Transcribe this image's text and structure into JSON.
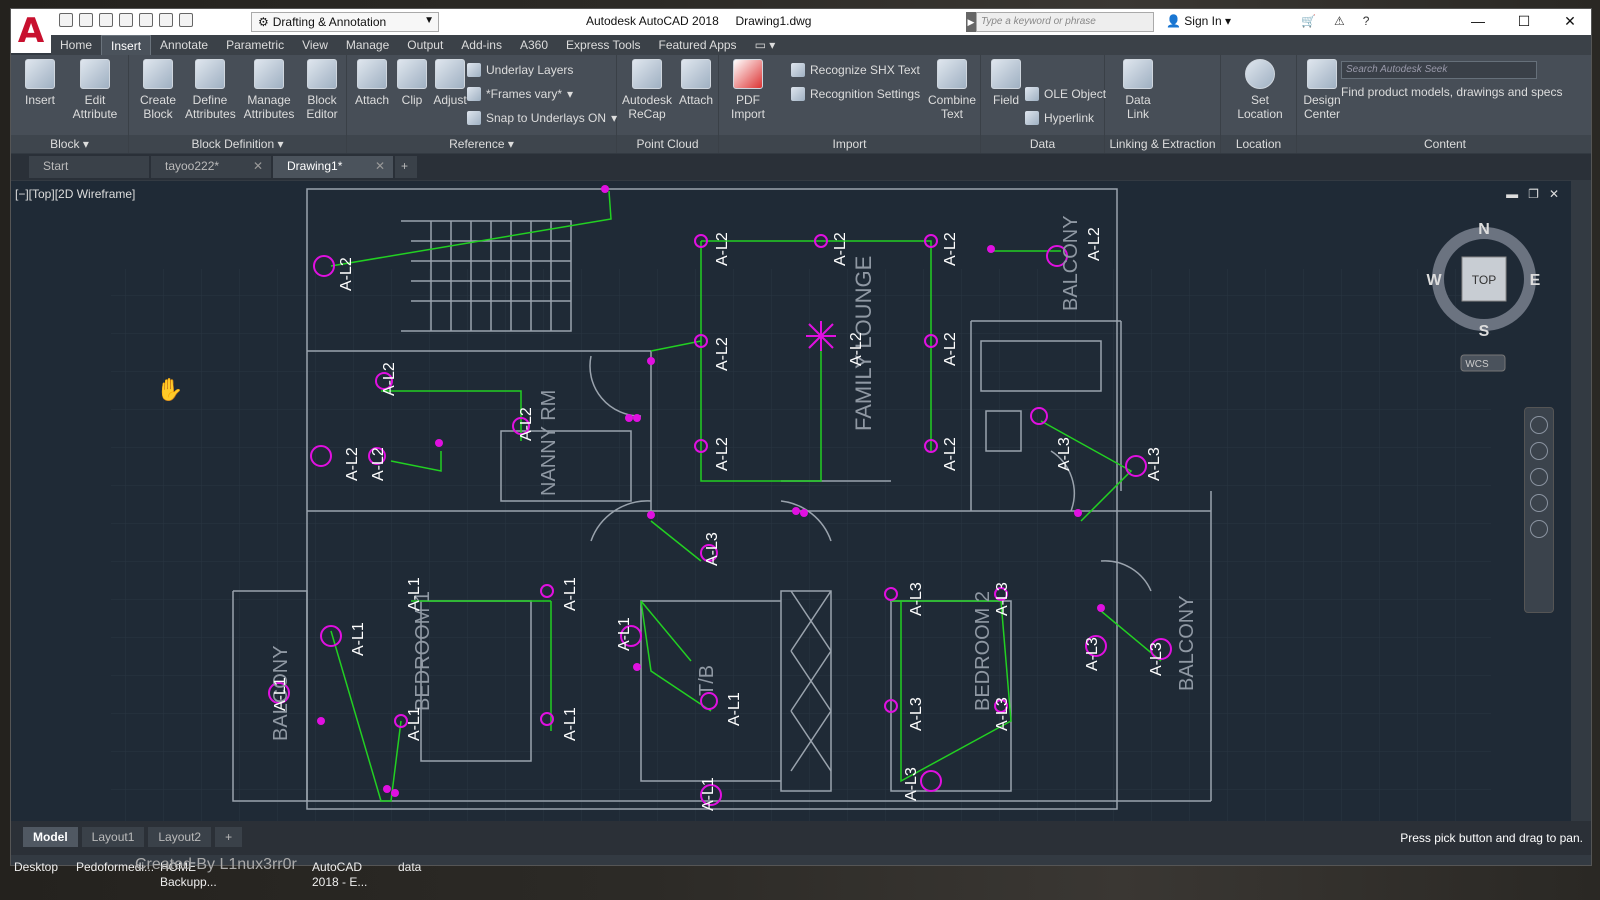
{
  "app": {
    "title": "Autodesk AutoCAD 2018",
    "filename": "Drawing1.dwg",
    "workspace": "Drafting & Annotation",
    "search_placeholder": "Type a keyword or phrase",
    "sign_in": "Sign In"
  },
  "menu_tabs": [
    "Home",
    "Insert",
    "Annotate",
    "Parametric",
    "View",
    "Manage",
    "Output",
    "Add-ins",
    "A360",
    "Express Tools",
    "Featured Apps"
  ],
  "active_tab": "Insert",
  "ribbon": {
    "block": {
      "label": "Block",
      "insert": "Insert",
      "edit_attribute": "Edit\nAttribute"
    },
    "block_def": {
      "label": "Block Definition",
      "create_block": "Create\nBlock",
      "define_attributes": "Define\nAttributes",
      "manage_attributes": "Manage\nAttributes",
      "block_editor": "Block\nEditor"
    },
    "reference": {
      "label": "Reference",
      "attach": "Attach",
      "clip": "Clip",
      "adjust": "Adjust",
      "underlay_layers": "Underlay Layers",
      "frames_vary": "*Frames vary*",
      "snap_underlays": "Snap to Underlays ON"
    },
    "point_cloud": {
      "label": "Point Cloud",
      "recap": "Autodesk\nReCap",
      "attach": "Attach"
    },
    "import": {
      "label": "Import",
      "pdf_import": "PDF\nImport",
      "recognize_shx": "Recognize SHX Text",
      "recognition_settings": "Recognition Settings",
      "combine_text": "Combine\nText"
    },
    "data": {
      "label": "Data",
      "field": "Field",
      "ole_object": "OLE Object",
      "hyperlink": "Hyperlink"
    },
    "linking": {
      "label": "Linking & Extraction",
      "data_link": "Data\nLink"
    },
    "location": {
      "label": "Location",
      "set_location": "Set\nLocation"
    },
    "content": {
      "label": "Content",
      "design_center": "Design\nCenter",
      "seek_placeholder": "Search Autodesk Seek",
      "seek_text": "Find product models, drawings and specs"
    }
  },
  "doc_tabs": [
    {
      "label": "Start"
    },
    {
      "label": "tayoo222*"
    },
    {
      "label": "Drawing1*"
    }
  ],
  "viewport": {
    "label": "[−][Top][2D Wireframe]",
    "viewcube": {
      "n": "N",
      "s": "S",
      "e": "E",
      "w": "W",
      "top": "TOP",
      "wcs": "WCS"
    },
    "rooms": [
      "FAMILY LOUNGE",
      "NANNY RM",
      "BALCONY",
      "BEDROOM 1",
      "BEDROOM 2",
      "BALCONY",
      "BALCONY",
      "T/B"
    ],
    "tags": [
      "A-L2",
      "A-L1",
      "A-L3"
    ]
  },
  "layout_tabs": [
    "Model",
    "Layout1",
    "Layout2"
  ],
  "status_text": "Press pick button and drag to pan.",
  "taskbar": {
    "items": [
      "Desktop",
      "Pedoformedi...",
      "HOME\nBackupp...",
      "AutoCAD\n2018 - E...",
      "data"
    ],
    "watermark": "Created By L1nux3rr0r"
  },
  "colors": {
    "accent": "#c8102e",
    "magenta": "#e010e0",
    "green": "#22d022",
    "lines": "#9aa3ad",
    "bg": "#1f2a36"
  }
}
